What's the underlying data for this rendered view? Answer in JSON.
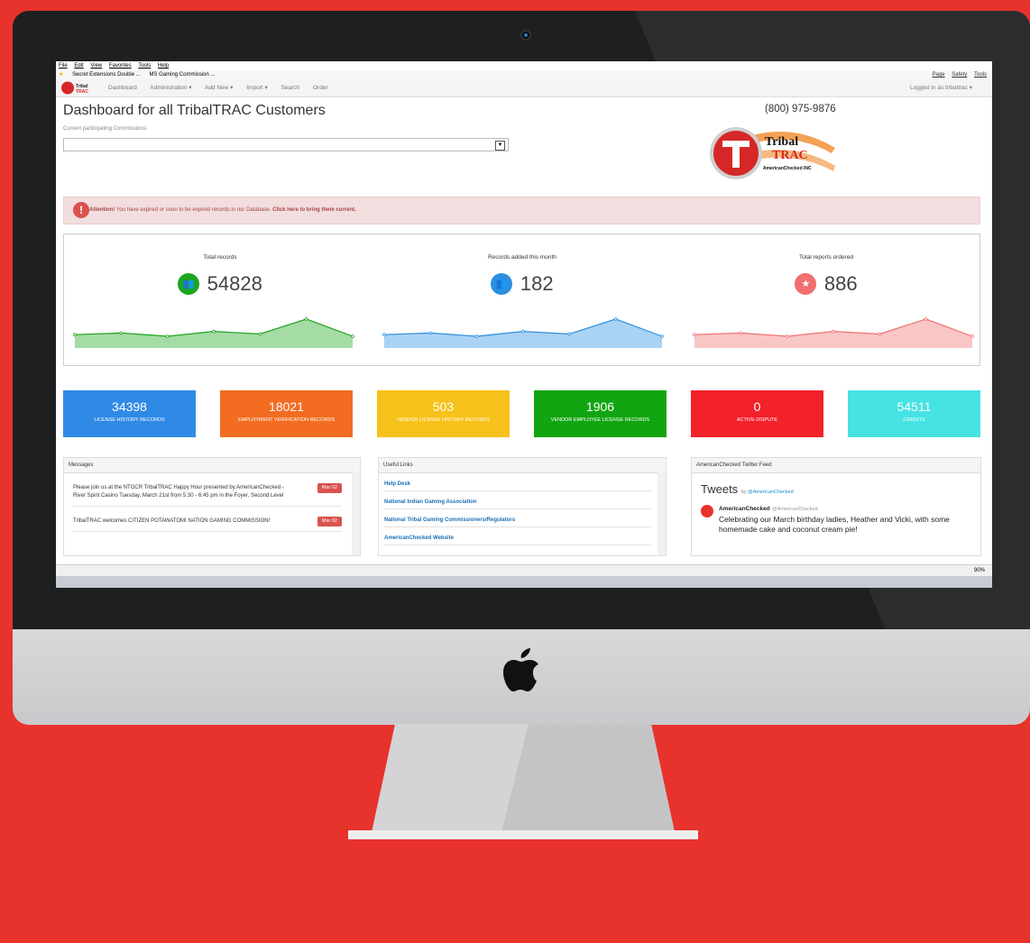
{
  "ie": {
    "menu": [
      "File",
      "Edit",
      "View",
      "Favorites",
      "Tools",
      "Help"
    ],
    "favorites": [
      "Secret Extensions Double ...",
      "MS Gaming Commission ..."
    ],
    "tools": [
      "Page",
      "Safety",
      "Tools"
    ],
    "zoom": "90%"
  },
  "nav": {
    "items": [
      "Dashboard",
      "Administration ▾",
      "Add New ▾",
      "Import ▾",
      "Search",
      "Order"
    ],
    "user": "Logged in as tribaltrac ▾"
  },
  "page": {
    "title": "Dashboard for all TribalTRAC Customers",
    "commissions_label": "Current participating Commissions:",
    "phone": "(800) 975-9876"
  },
  "logo": {
    "line1": "Tribal",
    "line2": "TRAC",
    "tagline": "AmericanChecked INC"
  },
  "alert": {
    "lead": "Attention!",
    "text": " You have expired or soon to be expired records in our Database. ",
    "link": "Click here to bring them current."
  },
  "stats": [
    {
      "label": "Total records",
      "value": "54828",
      "color": "#1ea51e",
      "trend": [
        0.3,
        0.35,
        0.25,
        0.4,
        0.32,
        0.78,
        0.25
      ]
    },
    {
      "label": "Records added this month",
      "value": "182",
      "color": "#2b8fe0",
      "trend": [
        0.3,
        0.35,
        0.25,
        0.4,
        0.32,
        0.78,
        0.25
      ]
    },
    {
      "label": "Total reports ordered",
      "value": "886",
      "color": "#f07070",
      "trend": [
        0.3,
        0.35,
        0.25,
        0.4,
        0.32,
        0.78,
        0.25
      ]
    }
  ],
  "tiles": [
    {
      "value": "34398",
      "label": "LICENSE HISTORY RECORDS",
      "color": "#2f8ae6"
    },
    {
      "value": "18021",
      "label": "EMPLOYMENT VERIFICATION RECORDS",
      "color": "#f26c22"
    },
    {
      "value": "503",
      "label": "VENDOR LICENSE HISTORY RECORDS",
      "color": "#f6c11a"
    },
    {
      "value": "1906",
      "label": "VENDOR EMPLOYEE LICENSE RECORDS",
      "color": "#12a512"
    },
    {
      "value": "0",
      "label": "ACTIVE DISPUTE",
      "color": "#f2212a"
    },
    {
      "value": "54511",
      "label": "CREDITS",
      "color": "#45e3e3"
    }
  ],
  "messages": {
    "title": "Messages",
    "items": [
      {
        "text": "Please join us at the NTGCR TribalTRAC Happy Hour presented by AmericanChecked - River Spirit Casino Tuesday, March 21st from 5:30 - 6:45 pm in the Foyer, Second Level",
        "date": "Mar 02"
      },
      {
        "text": "TribalTRAC welcomes CITIZEN POTAWATOMI NATION GAMING COMMISSION!",
        "date": "Mar 02"
      }
    ]
  },
  "links": {
    "title": "Useful Links",
    "items": [
      "Help Desk",
      "National Indian Gaming Association",
      "National Tribal Gaming Commissioners/Regulators",
      "AmericanChecked Website"
    ]
  },
  "twitter": {
    "title": "AmericanChecked Twitter Feed",
    "heading": "Tweets",
    "by": "by",
    "by_handle": "@AmericanChecked",
    "tweet": {
      "name": "AmericanChecked",
      "handle": "@AmericanChecked",
      "text": "Celebrating our March birthday ladies, Heather and Vicki, with some homemade cake and coconut cream pie!"
    }
  }
}
